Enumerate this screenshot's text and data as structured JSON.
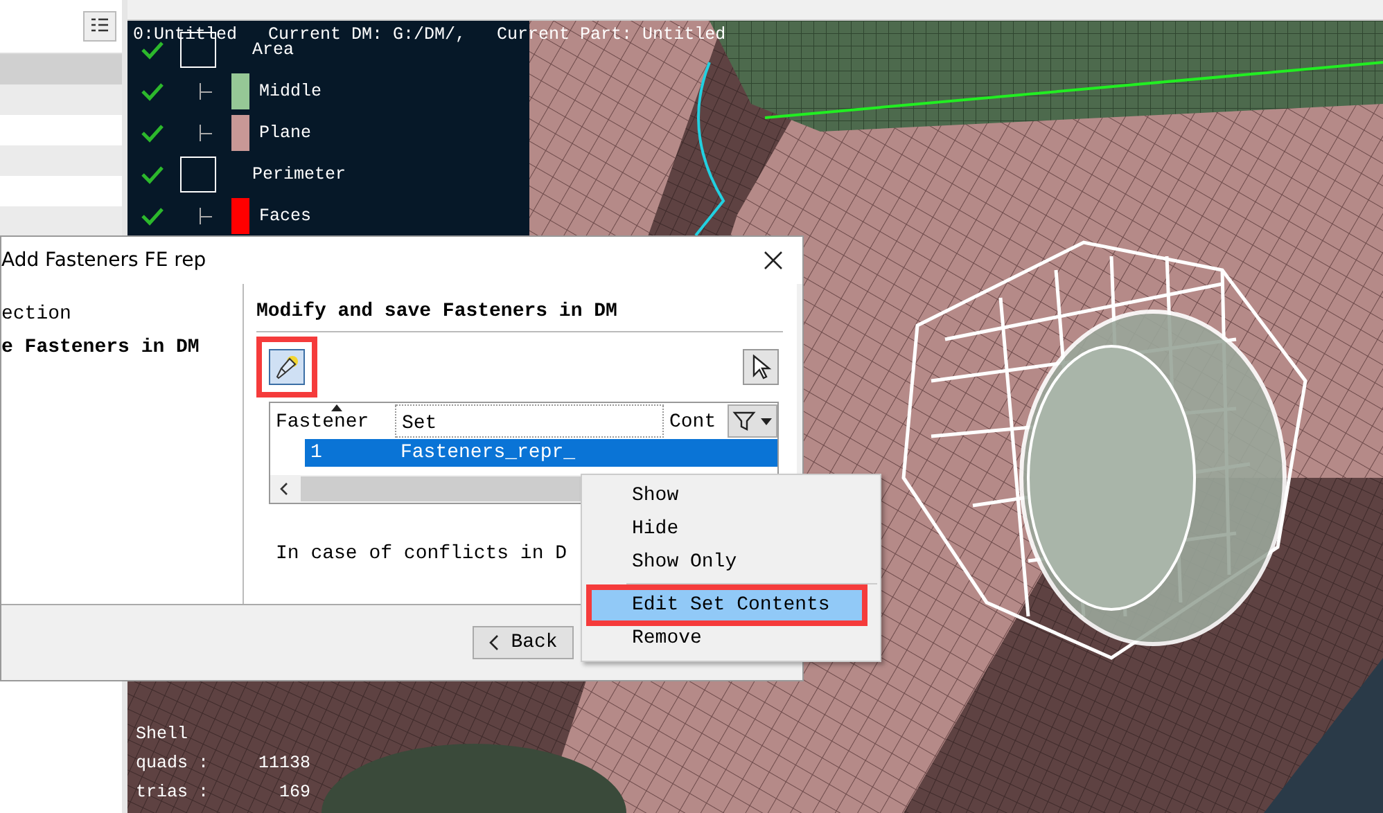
{
  "sidebar": {
    "rows": [
      {
        "selected": true
      },
      {
        "selected": false
      },
      {
        "selected": false
      },
      {
        "selected": false
      },
      {
        "selected": false
      },
      {
        "selected": false
      }
    ]
  },
  "viewport": {
    "status_line": "0:Untitled   Current DM: G:/DM/,   Current Part: Untitled",
    "legend": [
      {
        "kind": "group",
        "label": "Area",
        "checked": true
      },
      {
        "kind": "child",
        "label": "Middle",
        "checked": true,
        "color": "#96c896"
      },
      {
        "kind": "child",
        "label": "Plane",
        "checked": true,
        "color": "#c89896"
      },
      {
        "kind": "group",
        "label": "Perimeter",
        "checked": true
      },
      {
        "kind": "child",
        "label": "Faces",
        "checked": true,
        "color": "#ff0000"
      }
    ],
    "stats": {
      "title": "Shell",
      "rows": [
        {
          "label": "quads :",
          "value": "11138"
        },
        {
          "label": "trias :",
          "value": "169"
        }
      ]
    }
  },
  "dialog": {
    "title": "Add Fasteners FE rep",
    "steps": [
      {
        "label": "ection",
        "selected": false
      },
      {
        "label": "e Fasteners in DM",
        "selected": true
      }
    ],
    "heading": "Modify and save Fasteners in DM",
    "tools": [
      {
        "kind": "flashlight",
        "annotated": true
      },
      {
        "kind": "pointer",
        "annotated": false
      }
    ],
    "table": {
      "columns": [
        {
          "label": "Fastener",
          "sorted": true
        },
        {
          "label": "Set",
          "sorted": false
        },
        {
          "label": "Cont",
          "sorted": false
        }
      ],
      "rows": [
        {
          "cells": [
            "1",
            "Fasteners_repr_"
          ],
          "selected": true
        }
      ]
    },
    "note": "In case of conflicts in D",
    "buttons": [
      {
        "label": "Back"
      }
    ]
  },
  "context_menu": {
    "items": [
      {
        "label": "Show",
        "selected": false,
        "annotated": false
      },
      {
        "label": "Hide",
        "selected": false,
        "annotated": false
      },
      {
        "label": "Show Only",
        "selected": false,
        "annotated": false
      },
      {
        "kind": "separator"
      },
      {
        "label": "Edit Set Contents",
        "selected": true,
        "annotated": true
      },
      {
        "label": "Remove",
        "selected": false,
        "annotated": false
      }
    ]
  }
}
